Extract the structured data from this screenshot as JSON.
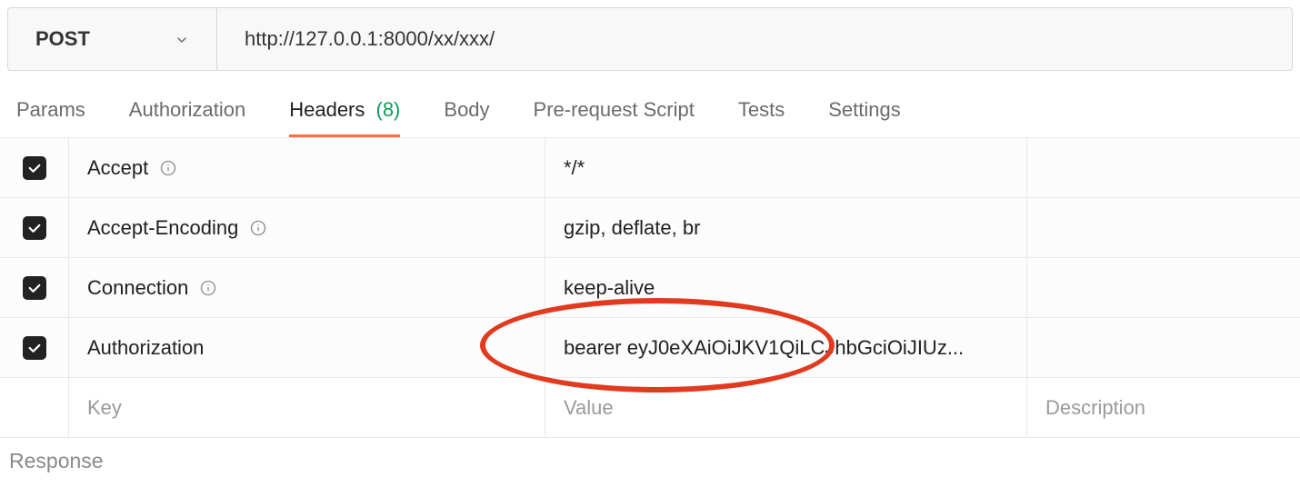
{
  "request": {
    "method": "POST",
    "url": "http://127.0.0.1:8000/xx/xxx/"
  },
  "tabs": {
    "params": "Params",
    "authorization": "Authorization",
    "headers": "Headers",
    "headers_count": "(8)",
    "body": "Body",
    "prerequest": "Pre-request Script",
    "tests": "Tests",
    "settings": "Settings"
  },
  "headers": [
    {
      "checked": true,
      "key": "Accept",
      "value": "*/*",
      "info": true
    },
    {
      "checked": true,
      "key": "Accept-Encoding",
      "value": "gzip, deflate, br",
      "info": true
    },
    {
      "checked": true,
      "key": "Connection",
      "value": "keep-alive",
      "info": true
    },
    {
      "checked": true,
      "key": "Authorization",
      "value": "bearer eyJ0eXAiOiJKV1QiLCJhbGciOiJIUz...",
      "info": false
    }
  ],
  "placeholder_row": {
    "key": "Key",
    "value": "Value",
    "description": "Description"
  },
  "response_label": "Response"
}
